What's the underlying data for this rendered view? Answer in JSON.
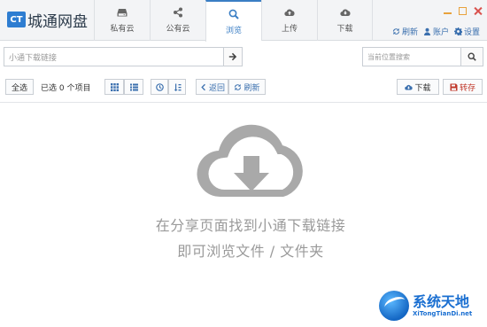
{
  "app": {
    "logo_mark": "CT",
    "logo_text": "城通网盘"
  },
  "tabs": [
    {
      "label": "私有云",
      "icon": "drive-icon"
    },
    {
      "label": "公有云",
      "icon": "share-icon"
    },
    {
      "label": "浏览",
      "icon": "search-icon",
      "active": true
    },
    {
      "label": "上传",
      "icon": "cloud-upload-icon"
    },
    {
      "label": "下载",
      "icon": "cloud-download-icon"
    }
  ],
  "header_actions": {
    "refresh": "刷新",
    "account": "账户",
    "settings": "设置"
  },
  "search": {
    "url_placeholder": "小通下载链接",
    "local_placeholder": "当前位置搜索"
  },
  "toolbar": {
    "select_all": "全选",
    "selected_count": "已选 0 个项目",
    "back": "返回",
    "refresh": "刷新",
    "download": "下载",
    "save_to": "转存"
  },
  "empty_state": {
    "line1": "在分享页面找到小通下载链接",
    "line2": "即可浏览文件 / 文件夹"
  },
  "watermark": {
    "cn": "系统天地",
    "en": "XiTongTianDi.net"
  },
  "colors": {
    "accent": "#3a7ec4",
    "danger": "#c0392b",
    "empty_text": "#9a9a9a"
  }
}
